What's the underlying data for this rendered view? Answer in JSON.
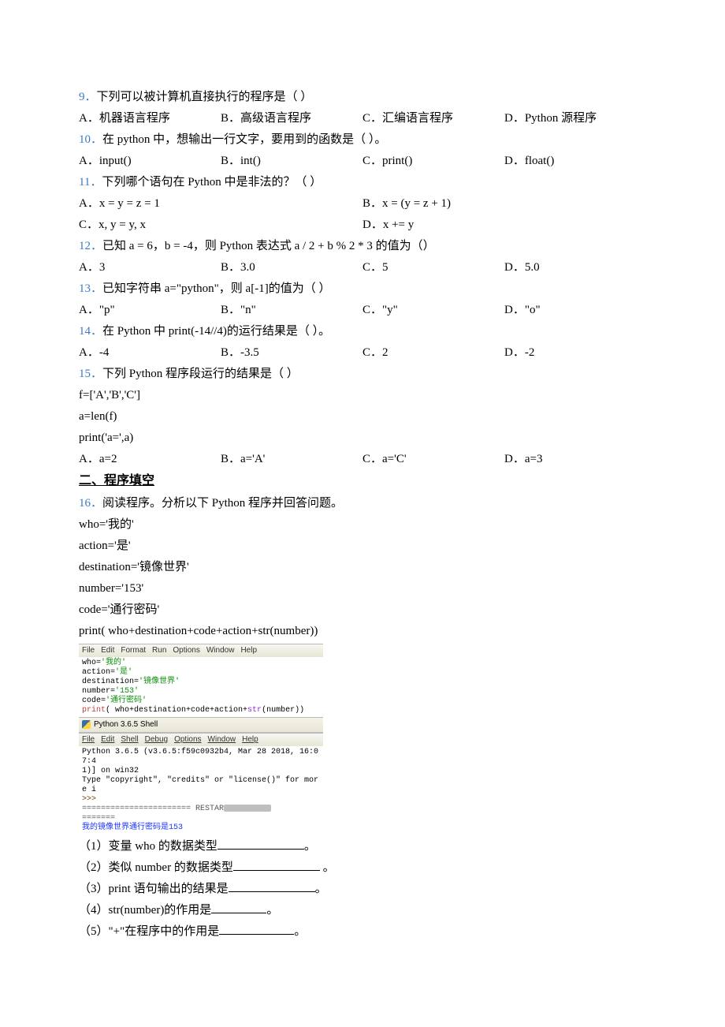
{
  "q9": {
    "num": "9．",
    "stem": "下列可以被计算机直接执行的程序是（   ）",
    "A": "A．机器语言程序",
    "B": "B．高级语言程序",
    "C": "C．汇编语言程序",
    "D": "D．Python 源程序"
  },
  "q10": {
    "num": "10．",
    "stem": "在 python 中，想输出一行文字，要用到的函数是（    ）。",
    "A": "A．input()",
    "B": "B．int()",
    "C": "C．print()",
    "D": "D．float()"
  },
  "q11": {
    "num": "11．",
    "stem": "下列哪个语句在 Python 中是非法的？（   ）",
    "A": "A．x = y = z = 1",
    "B": "B．x = (y = z + 1)",
    "C": "C．x, y = y, x",
    "D": "D．x += y"
  },
  "q12": {
    "num": "12．",
    "stem": "已知 a = 6，b = -4，则 Python 表达式 a / 2 + b % 2 * 3 的值为（）",
    "A": "A．3",
    "B": "B．3.0",
    "C": "C．5",
    "D": "D．5.0"
  },
  "q13": {
    "num": "13．",
    "stem": "已知字符串 a=\"python\"，则 a[-1]的值为（  ）",
    "A": "A．\"p\"",
    "B": "B．\"n\"",
    "C": "C．\"y\"",
    "D": "D．\"o\""
  },
  "q14": {
    "num": "14．",
    "stem": "在 Python 中 print(-14//4)的运行结果是（  ）。",
    "A": "A．-4",
    "B": "B．-3.5",
    "C": "C．2",
    "D": "D．-2"
  },
  "q15": {
    "num": "15．",
    "stem": "下列 Python 程序段运行的结果是（    ）",
    "code1": "f=['A','B','C']",
    "code2": "a=len(f)",
    "code3": "print('a=',a)",
    "A": "A．a=2",
    "B": "B．a='A'",
    "C": "C．a='C'",
    "D": "D．a=3"
  },
  "section2": "二、程序填空",
  "q16": {
    "num": "16．",
    "stem": "阅读程序。分析以下 Python 程序并回答问题。",
    "c1": "who='我的'",
    "c2": "action='是'",
    "c3": "destination='镜像世界'",
    "c4": "number='153'",
    "c5": "code='通行密码'",
    "c6": "print( who+destination+code+action+str(number))",
    "sub1a": "（1）变量 who 的数据类型",
    "sub1b": "。",
    "sub2a": "（2）类似 number 的数据类型",
    "sub2b": " 。",
    "sub3a": "（3）print 语句输出的结果是",
    "sub3b": "。",
    "sub4a": "（4）str(number)的作用是",
    "sub4b": "。",
    "sub5a": "（5）\"+\"在程序中的作用是",
    "sub5b": "。"
  },
  "ss": {
    "menu1": {
      "file": "File",
      "edit": "Edit",
      "format": "Format",
      "run": "Run",
      "options": "Options",
      "window": "Window",
      "help": "Help"
    },
    "code_who_k": "who=",
    "code_who_v": "'我的'",
    "code_action_k": "action=",
    "code_action_v": "'是'",
    "code_dest_k": "destination=",
    "code_dest_v": "'镜像世界'",
    "code_num_k": "number=",
    "code_num_v": "'153'",
    "code_code_k": "code=",
    "code_code_v": "'通行密码'",
    "code_print_a": "print",
    "code_print_b": "( who+destination+code+action+",
    "code_print_c": "str",
    "code_print_d": "(number))",
    "shelltitle": "Python 3.6.5 Shell",
    "menu2": {
      "file": "File",
      "edit": "Edit",
      "shell": "Shell",
      "debug": "Debug",
      "options": "Options",
      "window": "Window",
      "help": "Help"
    },
    "shell_line1": "Python 3.6.5 (v3.6.5:f59c0932b4, Mar 28 2018, 16:07:4",
    "shell_line2": "1)] on win32",
    "shell_line3": "Type \"copyright\", \"credits\" or \"license()\" for more i",
    "shell_prompt": ">>>",
    "shell_restart_a": "======================= RESTAR",
    "shell_restart_b": "=======",
    "shell_result": "我的镜像世界通行密码是153"
  }
}
